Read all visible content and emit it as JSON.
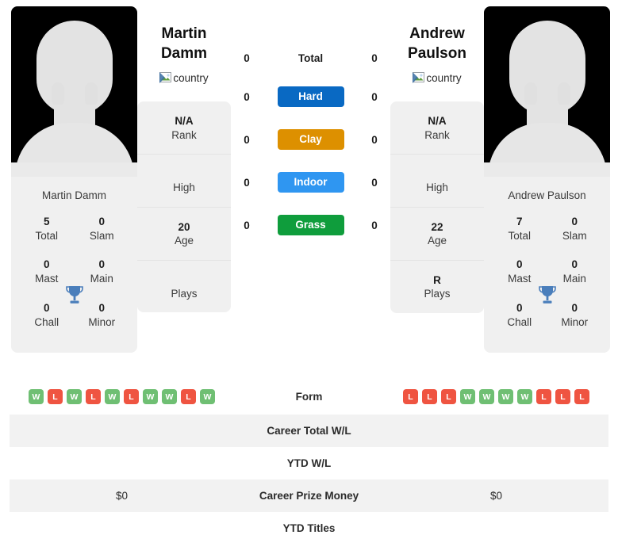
{
  "players": {
    "left": {
      "heading_line1": "Martin",
      "heading_line2": "Damm",
      "card_name": "Martin Damm",
      "country_alt": "country",
      "titles": {
        "total_value": "5",
        "total_label": "Total",
        "slam_value": "0",
        "slam_label": "Slam",
        "mast_value": "0",
        "mast_label": "Mast",
        "main_value": "0",
        "main_label": "Main",
        "chall_value": "0",
        "chall_label": "Chall",
        "minor_value": "0",
        "minor_label": "Minor"
      },
      "info": {
        "rank_value": "N/A",
        "rank_label": "Rank",
        "high_value": "",
        "high_label": "High",
        "age_value": "20",
        "age_label": "Age",
        "plays_value": "",
        "plays_label": "Plays"
      },
      "form": [
        "W",
        "L",
        "W",
        "L",
        "W",
        "L",
        "W",
        "W",
        "L",
        "W"
      ],
      "career_total_wl": "",
      "ytd_wl": "",
      "career_prize_money": "$0",
      "ytd_titles": ""
    },
    "right": {
      "heading_line1": "Andrew",
      "heading_line2": "Paulson",
      "card_name": "Andrew Paulson",
      "country_alt": "country",
      "titles": {
        "total_value": "7",
        "total_label": "Total",
        "slam_value": "0",
        "slam_label": "Slam",
        "mast_value": "0",
        "mast_label": "Mast",
        "main_value": "0",
        "main_label": "Main",
        "chall_value": "0",
        "chall_label": "Chall",
        "minor_value": "0",
        "minor_label": "Minor"
      },
      "info": {
        "rank_value": "N/A",
        "rank_label": "Rank",
        "high_value": "",
        "high_label": "High",
        "age_value": "22",
        "age_label": "Age",
        "plays_value": "R",
        "plays_label": "Plays"
      },
      "form": [
        "L",
        "L",
        "L",
        "W",
        "W",
        "W",
        "W",
        "L",
        "L",
        "L"
      ],
      "career_total_wl": "",
      "ytd_wl": "",
      "career_prize_money": "$0",
      "ytd_titles": ""
    }
  },
  "head_to_head": {
    "rows": [
      {
        "label": "Total",
        "left": "0",
        "right": "0",
        "style": "plain",
        "color": ""
      },
      {
        "label": "Hard",
        "left": "0",
        "right": "0",
        "style": "badge",
        "color": "#0969c3"
      },
      {
        "label": "Clay",
        "left": "0",
        "right": "0",
        "style": "badge",
        "color": "#dd9000"
      },
      {
        "label": "Indoor",
        "left": "0",
        "right": "0",
        "style": "badge",
        "color": "#2f96f1"
      },
      {
        "label": "Grass",
        "left": "0",
        "right": "0",
        "style": "badge",
        "color": "#0f9d3c"
      }
    ]
  },
  "stats_table": {
    "rows": [
      {
        "label": "Form",
        "key": "form",
        "type": "form",
        "shaded": false
      },
      {
        "label": "Career Total W/L",
        "key": "career_total_wl",
        "type": "text",
        "shaded": true
      },
      {
        "label": "YTD W/L",
        "key": "ytd_wl",
        "type": "text",
        "shaded": false
      },
      {
        "label": "Career Prize Money",
        "key": "career_prize_money",
        "type": "text",
        "shaded": true
      },
      {
        "label": "YTD Titles",
        "key": "ytd_titles",
        "type": "text",
        "shaded": false
      }
    ]
  },
  "colors": {
    "trophy": "#4a7ebb",
    "win_badge": "#6fbf73",
    "loss_badge": "#ef5441",
    "card_bg": "#f0f0f0",
    "row_shade": "#f2f2f2"
  }
}
